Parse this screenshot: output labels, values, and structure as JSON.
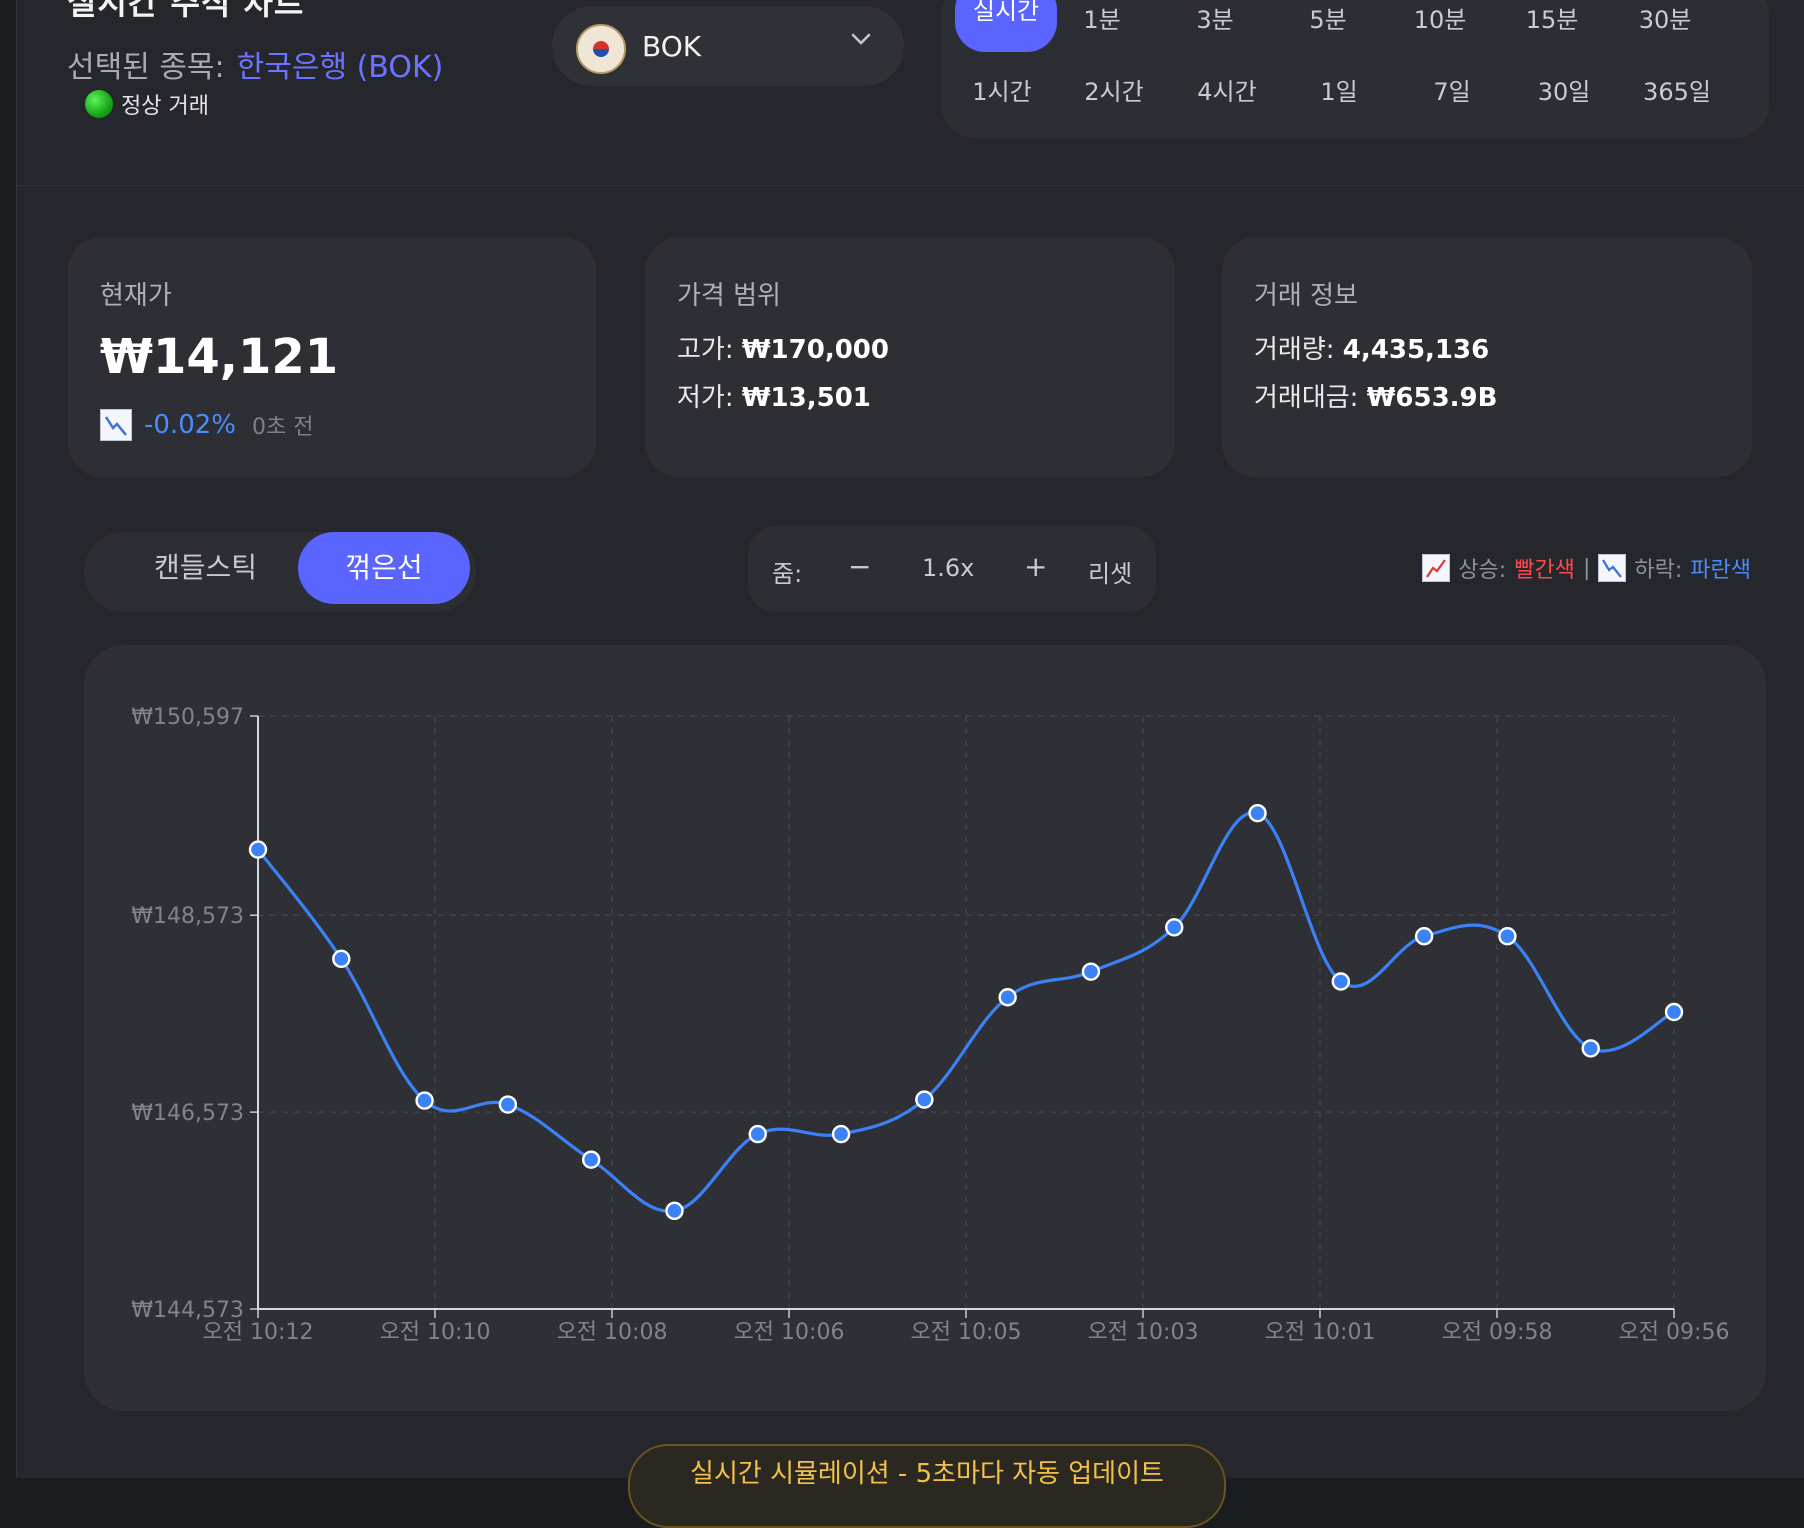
{
  "header": {
    "title": "실시간 주식 차트",
    "selected_label": "선택된 종목:",
    "selected_value": "한국은행 (BOK)",
    "status": "정상 거래"
  },
  "stock_select": {
    "symbol": "BOK",
    "logo": "bank-of-korea-emblem-icon"
  },
  "timeframes": {
    "row1": [
      "실시간",
      "1분",
      "3분",
      "5분",
      "10분",
      "15분",
      "30분"
    ],
    "row2": [
      "1시간",
      "2시간",
      "4시간",
      "1일",
      "7일",
      "30일",
      "365일"
    ],
    "active": "실시간"
  },
  "cards": {
    "current": {
      "label": "현재가",
      "price": "₩14,121",
      "change": "-0.02%",
      "ago": "0초 전"
    },
    "range": {
      "label": "가격 범위",
      "high_label": "고가:",
      "high": "₩170,000",
      "low_label": "저가:",
      "low": "₩13,501"
    },
    "trade": {
      "label": "거래 정보",
      "volume_label": "거래량:",
      "volume": "4,435,136",
      "value_label": "거래대금:",
      "value": "₩653.9B"
    }
  },
  "chart_toggle": {
    "candle": "캔들스틱",
    "line": "꺾은선",
    "active": "꺾은선"
  },
  "zoom": {
    "label": "줌:",
    "minus": "−",
    "level": "1.6x",
    "plus": "+",
    "reset": "리셋"
  },
  "legend": {
    "up_label": "상승:",
    "up_color_name": "빨간색",
    "sep": "|",
    "down_label": "하락:",
    "down_color_name": "파란색",
    "up_color": "#ff4a4a",
    "down_color": "#4a8cff"
  },
  "colors": {
    "accent": "#5a64ff",
    "line": "#3b82f6"
  },
  "banner": {
    "text": "실시간 시뮬레이션 - 5초마다 자동 업데이트"
  },
  "chart_data": {
    "type": "line",
    "y_ticks": [
      "₩150,597",
      "₩148,573",
      "₩146,573",
      "₩144,573"
    ],
    "ylim": [
      144573,
      150597
    ],
    "x_ticks": [
      "오전 10:12",
      "오전 10:10",
      "오전 10:08",
      "오전 10:06",
      "오전 10:05",
      "오전 10:03",
      "오전 10:01",
      "오전 09:58",
      "오전 09:56"
    ],
    "grid": true,
    "values": [
      149240,
      148130,
      146690,
      146650,
      146090,
      145570,
      146350,
      146350,
      146700,
      147740,
      148000,
      148450,
      149610,
      147900,
      148360,
      148360,
      147220,
      147590
    ]
  }
}
